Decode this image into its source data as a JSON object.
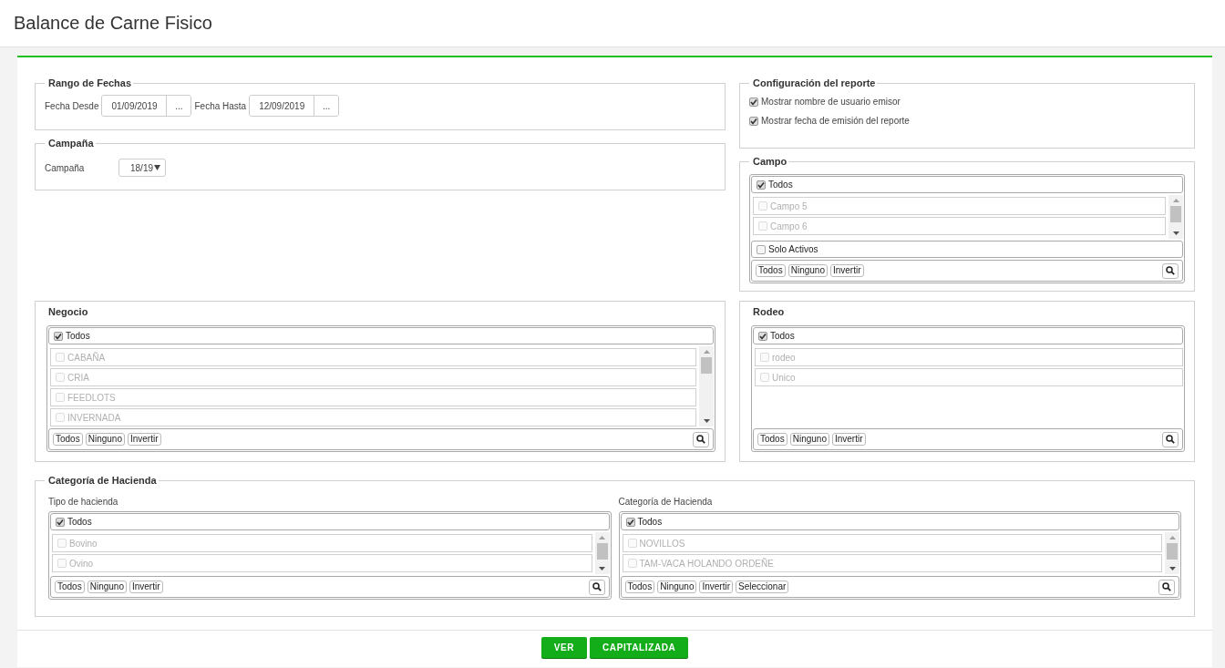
{
  "page": {
    "title": "Balance de Carne Fisico"
  },
  "date_range": {
    "legend": "Rango de Fechas",
    "fields": [
      {
        "label": "Fecha Desde",
        "value": "01/09/2019",
        "button": "..."
      },
      {
        "label": "Fecha Hasta",
        "value": "12/09/2019",
        "button": "..."
      }
    ]
  },
  "season": {
    "legend": "Campaña",
    "label": "Campaña",
    "value": "18/19"
  },
  "report_config": {
    "legend": "Configuración del reporte",
    "options": [
      {
        "label": "Mostrar nombre de usuario emisor",
        "checked": true
      },
      {
        "label": "Mostrar fecha de emisión del reporte",
        "checked": true
      }
    ]
  },
  "field_filter": {
    "legend": "Campo",
    "list": {
      "all": {
        "label": "Todos",
        "checked": true
      },
      "scrollable": true,
      "items": [
        {
          "label": "Campo 5",
          "checked": false,
          "disabled": true
        },
        {
          "label": "Campo 6",
          "checked": false,
          "disabled": true
        }
      ],
      "filter": {
        "label": "Solo Activos",
        "checked": false
      },
      "buttons": [
        "Todos",
        "Ninguno",
        "Invertir"
      ]
    }
  },
  "business": {
    "title": "Negocio",
    "list": {
      "all": {
        "label": "Todos",
        "checked": true
      },
      "scrollable": true,
      "items": [
        {
          "label": "CABAÑA",
          "checked": false,
          "disabled": true
        },
        {
          "label": "CRIA",
          "checked": false,
          "disabled": true
        },
        {
          "label": "FEEDLOTS",
          "checked": false,
          "disabled": true
        },
        {
          "label": "INVERNADA",
          "checked": false,
          "disabled": true
        }
      ],
      "buttons": [
        "Todos",
        "Ninguno",
        "Invertir"
      ]
    }
  },
  "herd": {
    "title": "Rodeo",
    "list": {
      "all": {
        "label": "Todos",
        "checked": true
      },
      "scrollable": false,
      "items": [
        {
          "label": "rodeo",
          "checked": false,
          "disabled": true
        },
        {
          "label": "Unico",
          "checked": false,
          "disabled": true
        }
      ],
      "buttons": [
        "Todos",
        "Ninguno",
        "Invertir"
      ]
    }
  },
  "livestock_category": {
    "legend": "Categoría de Hacienda",
    "lists": [
      {
        "label": "Tipo de hacienda",
        "list": {
          "all": {
            "label": "Todos",
            "checked": true
          },
          "scrollable": true,
          "items": [
            {
              "label": "Bovino",
              "checked": false,
              "disabled": true
            },
            {
              "label": "Ovino",
              "checked": false,
              "disabled": true
            }
          ],
          "buttons": [
            "Todos",
            "Ninguno",
            "Invertir"
          ]
        }
      },
      {
        "label": "Categoría de Hacienda",
        "list": {
          "all": {
            "label": "Todos",
            "checked": true
          },
          "scrollable": true,
          "items": [
            {
              "label": "NOVILLOS",
              "checked": false,
              "disabled": true
            },
            {
              "label": "TAM-VACA HOLANDO ORDEÑE",
              "checked": false,
              "disabled": true
            }
          ],
          "buttons": [
            "Todos",
            "Ninguno",
            "Invertir",
            "Seleccionar"
          ]
        }
      }
    ]
  },
  "actions": [
    {
      "label": "VER"
    },
    {
      "label": "CAPITALIZADA"
    }
  ]
}
